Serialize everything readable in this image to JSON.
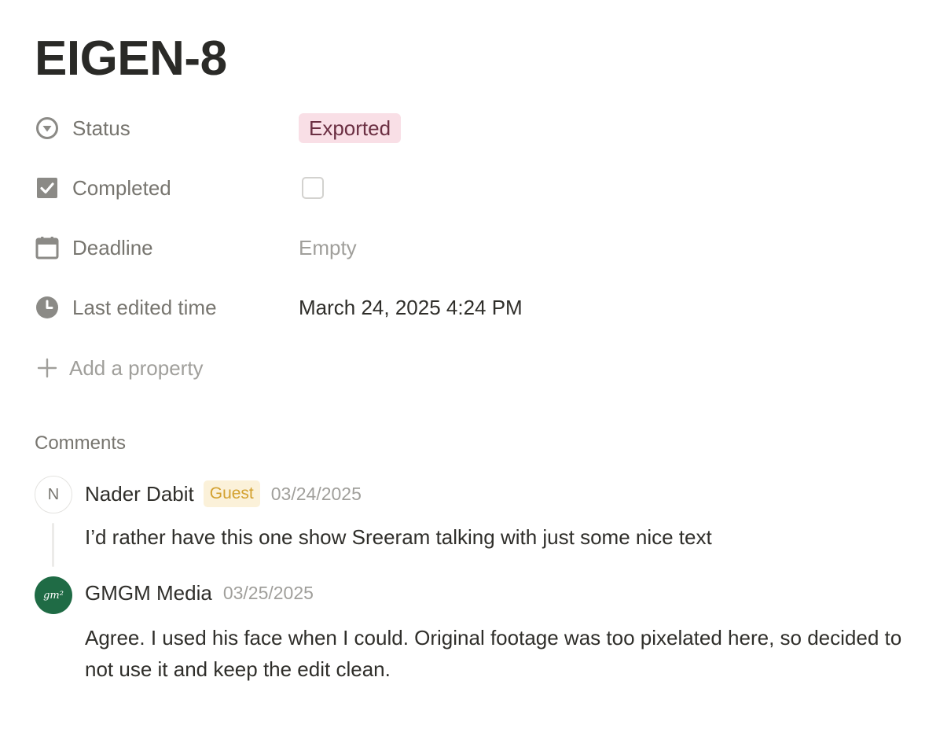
{
  "page": {
    "title": "EIGEN-8"
  },
  "properties": [
    {
      "icon": "status-icon",
      "label": "Status",
      "value": "Exported",
      "kind": "status"
    },
    {
      "icon": "checkbox-icon",
      "label": "Completed",
      "value": false,
      "kind": "checkbox"
    },
    {
      "icon": "calendar-icon",
      "label": "Deadline",
      "value": "Empty",
      "kind": "date"
    },
    {
      "icon": "clock-icon",
      "label": "Last edited time",
      "value": "March 24, 2025 4:24 PM",
      "kind": "text"
    }
  ],
  "add_property": {
    "icon": "plus-icon",
    "label": "Add a property"
  },
  "comments": {
    "heading": "Comments",
    "items": [
      {
        "avatar": "N",
        "author": "Nader Dabit",
        "badge": "Guest",
        "date": "03/24/2025",
        "text": "I’d rather have this one show Sreeram talking with just some nice text"
      },
      {
        "avatar": "gm²",
        "author": "GMGM Media",
        "date": "03/25/2025",
        "text": "Agree. I used his face when I could. Original footage was too pixelated here, so decided to not use it and keep the edit clean."
      }
    ]
  },
  "colors": {
    "status_bg": "#f9dfe6",
    "status_text": "#6b2f42",
    "guest_bg": "#fbf1d9",
    "guest_text": "#d3a130",
    "brand_avatar": "#1f6b45"
  }
}
